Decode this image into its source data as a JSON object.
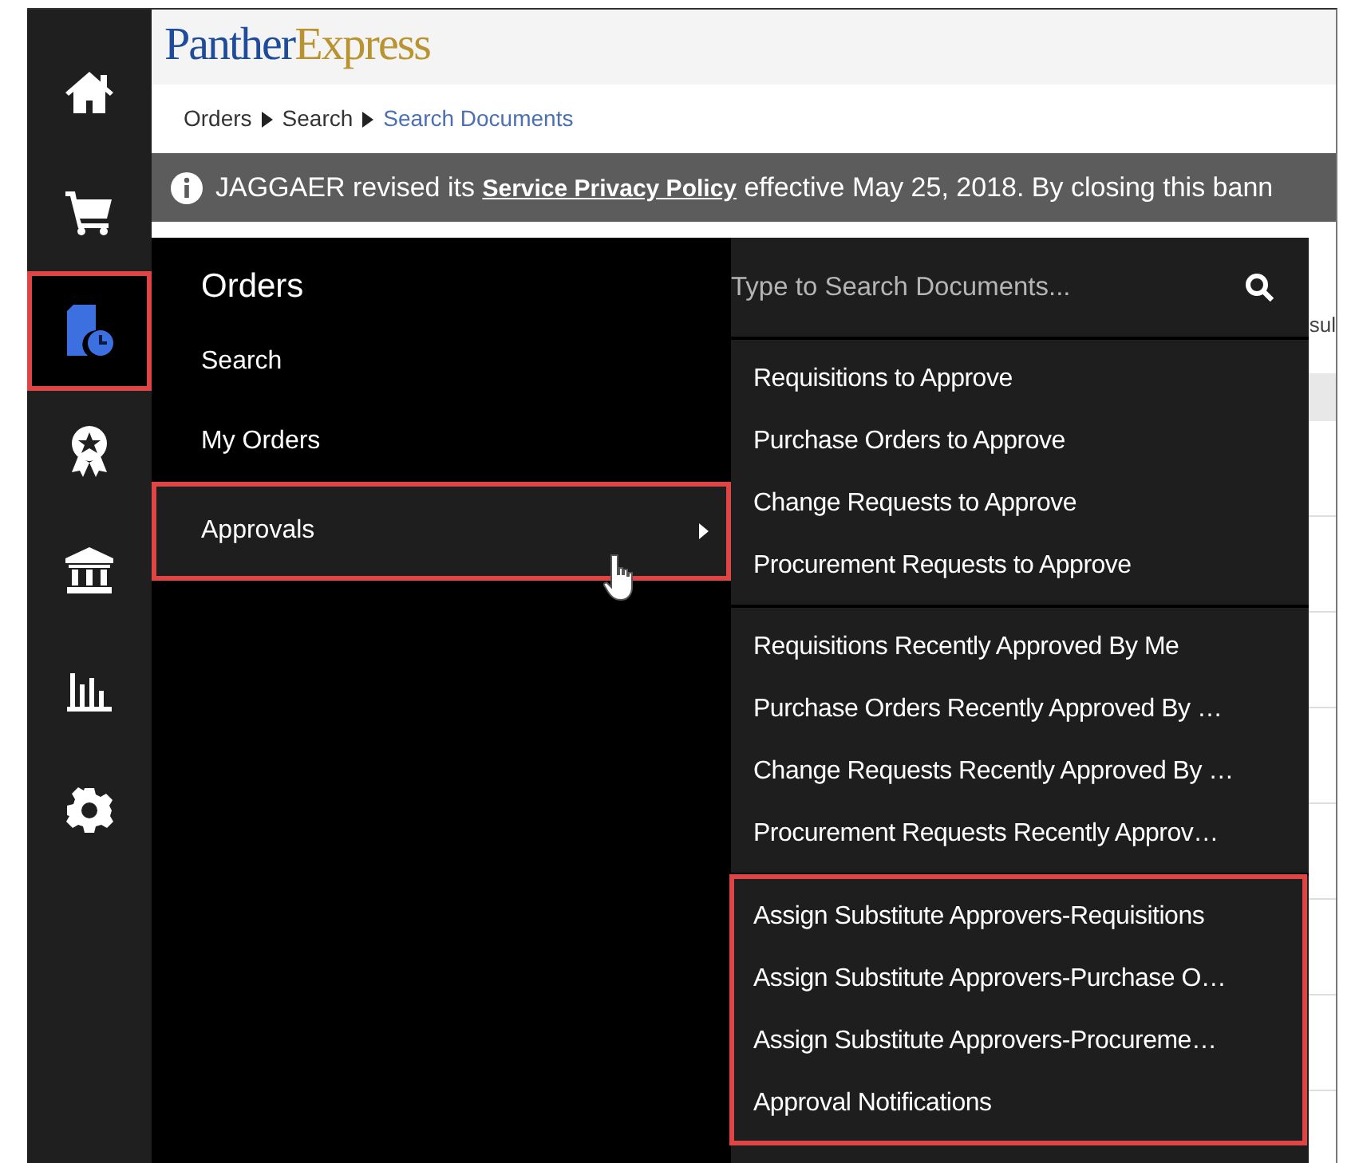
{
  "sidebar": {
    "items": [
      {
        "selected": false,
        "highlighted": false
      },
      {
        "selected": false,
        "highlighted": false
      },
      {
        "selected": true,
        "highlighted": true
      },
      {
        "selected": false,
        "highlighted": false
      },
      {
        "selected": false,
        "highlighted": false
      },
      {
        "selected": false,
        "highlighted": false
      },
      {
        "selected": false,
        "highlighted": false
      }
    ]
  },
  "logo": {
    "first": "Panther",
    "second": "Express"
  },
  "breadcrumb": [
    {
      "label": "Orders",
      "current": false
    },
    {
      "label": "Search",
      "current": false
    },
    {
      "label": "Search Documents",
      "current": true
    }
  ],
  "banner": {
    "text_before": "JAGGAER revised its ",
    "link": "Service Privacy Policy",
    "text_after": " effective May 25, 2018. By closing this bann"
  },
  "content_fragment": "sul",
  "menu": {
    "title": "Orders",
    "items": [
      {
        "label": "Search",
        "selected": false,
        "has_submenu": false,
        "highlighted": false
      },
      {
        "label": "My Orders",
        "selected": false,
        "has_submenu": false,
        "highlighted": false
      },
      {
        "label": "Approvals",
        "selected": true,
        "has_submenu": true,
        "highlighted": true
      }
    ]
  },
  "submenu": {
    "search": {
      "placeholder": "Type to Search Documents..."
    },
    "groups": [
      {
        "highlighted": false,
        "items": [
          "Requisitions to Approve",
          "Purchase Orders to Approve",
          "Change Requests to Approve",
          "Procurement Requests to Approve"
        ]
      },
      {
        "highlighted": false,
        "items": [
          "Requisitions Recently Approved By Me",
          "Purchase Orders Recently Approved By …",
          "Change Requests Recently Approved By …",
          "Procurement Requests Recently Approv…"
        ]
      },
      {
        "highlighted": true,
        "items": [
          "Assign Substitute Approvers-Requisitions",
          "Assign Substitute Approvers-Purchase O…",
          "Assign Substitute Approvers-Procureme…",
          "Approval Notifications"
        ]
      }
    ]
  }
}
